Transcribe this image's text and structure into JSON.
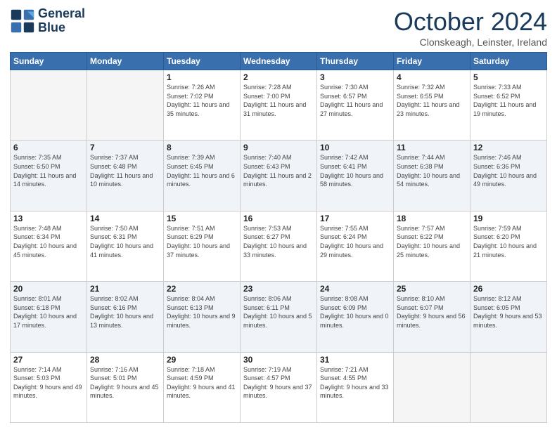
{
  "logo": {
    "line1": "General",
    "line2": "Blue"
  },
  "title": "October 2024",
  "subtitle": "Clonskeagh, Leinster, Ireland",
  "days_of_week": [
    "Sunday",
    "Monday",
    "Tuesday",
    "Wednesday",
    "Thursday",
    "Friday",
    "Saturday"
  ],
  "weeks": [
    [
      {
        "day": "",
        "info": ""
      },
      {
        "day": "",
        "info": ""
      },
      {
        "day": "1",
        "info": "Sunrise: 7:26 AM\nSunset: 7:02 PM\nDaylight: 11 hours and 35 minutes."
      },
      {
        "day": "2",
        "info": "Sunrise: 7:28 AM\nSunset: 7:00 PM\nDaylight: 11 hours and 31 minutes."
      },
      {
        "day": "3",
        "info": "Sunrise: 7:30 AM\nSunset: 6:57 PM\nDaylight: 11 hours and 27 minutes."
      },
      {
        "day": "4",
        "info": "Sunrise: 7:32 AM\nSunset: 6:55 PM\nDaylight: 11 hours and 23 minutes."
      },
      {
        "day": "5",
        "info": "Sunrise: 7:33 AM\nSunset: 6:52 PM\nDaylight: 11 hours and 19 minutes."
      }
    ],
    [
      {
        "day": "6",
        "info": "Sunrise: 7:35 AM\nSunset: 6:50 PM\nDaylight: 11 hours and 14 minutes."
      },
      {
        "day": "7",
        "info": "Sunrise: 7:37 AM\nSunset: 6:48 PM\nDaylight: 11 hours and 10 minutes."
      },
      {
        "day": "8",
        "info": "Sunrise: 7:39 AM\nSunset: 6:45 PM\nDaylight: 11 hours and 6 minutes."
      },
      {
        "day": "9",
        "info": "Sunrise: 7:40 AM\nSunset: 6:43 PM\nDaylight: 11 hours and 2 minutes."
      },
      {
        "day": "10",
        "info": "Sunrise: 7:42 AM\nSunset: 6:41 PM\nDaylight: 10 hours and 58 minutes."
      },
      {
        "day": "11",
        "info": "Sunrise: 7:44 AM\nSunset: 6:38 PM\nDaylight: 10 hours and 54 minutes."
      },
      {
        "day": "12",
        "info": "Sunrise: 7:46 AM\nSunset: 6:36 PM\nDaylight: 10 hours and 49 minutes."
      }
    ],
    [
      {
        "day": "13",
        "info": "Sunrise: 7:48 AM\nSunset: 6:34 PM\nDaylight: 10 hours and 45 minutes."
      },
      {
        "day": "14",
        "info": "Sunrise: 7:50 AM\nSunset: 6:31 PM\nDaylight: 10 hours and 41 minutes."
      },
      {
        "day": "15",
        "info": "Sunrise: 7:51 AM\nSunset: 6:29 PM\nDaylight: 10 hours and 37 minutes."
      },
      {
        "day": "16",
        "info": "Sunrise: 7:53 AM\nSunset: 6:27 PM\nDaylight: 10 hours and 33 minutes."
      },
      {
        "day": "17",
        "info": "Sunrise: 7:55 AM\nSunset: 6:24 PM\nDaylight: 10 hours and 29 minutes."
      },
      {
        "day": "18",
        "info": "Sunrise: 7:57 AM\nSunset: 6:22 PM\nDaylight: 10 hours and 25 minutes."
      },
      {
        "day": "19",
        "info": "Sunrise: 7:59 AM\nSunset: 6:20 PM\nDaylight: 10 hours and 21 minutes."
      }
    ],
    [
      {
        "day": "20",
        "info": "Sunrise: 8:01 AM\nSunset: 6:18 PM\nDaylight: 10 hours and 17 minutes."
      },
      {
        "day": "21",
        "info": "Sunrise: 8:02 AM\nSunset: 6:16 PM\nDaylight: 10 hours and 13 minutes."
      },
      {
        "day": "22",
        "info": "Sunrise: 8:04 AM\nSunset: 6:13 PM\nDaylight: 10 hours and 9 minutes."
      },
      {
        "day": "23",
        "info": "Sunrise: 8:06 AM\nSunset: 6:11 PM\nDaylight: 10 hours and 5 minutes."
      },
      {
        "day": "24",
        "info": "Sunrise: 8:08 AM\nSunset: 6:09 PM\nDaylight: 10 hours and 0 minutes."
      },
      {
        "day": "25",
        "info": "Sunrise: 8:10 AM\nSunset: 6:07 PM\nDaylight: 9 hours and 56 minutes."
      },
      {
        "day": "26",
        "info": "Sunrise: 8:12 AM\nSunset: 6:05 PM\nDaylight: 9 hours and 53 minutes."
      }
    ],
    [
      {
        "day": "27",
        "info": "Sunrise: 7:14 AM\nSunset: 5:03 PM\nDaylight: 9 hours and 49 minutes."
      },
      {
        "day": "28",
        "info": "Sunrise: 7:16 AM\nSunset: 5:01 PM\nDaylight: 9 hours and 45 minutes."
      },
      {
        "day": "29",
        "info": "Sunrise: 7:18 AM\nSunset: 4:59 PM\nDaylight: 9 hours and 41 minutes."
      },
      {
        "day": "30",
        "info": "Sunrise: 7:19 AM\nSunset: 4:57 PM\nDaylight: 9 hours and 37 minutes."
      },
      {
        "day": "31",
        "info": "Sunrise: 7:21 AM\nSunset: 4:55 PM\nDaylight: 9 hours and 33 minutes."
      },
      {
        "day": "",
        "info": ""
      },
      {
        "day": "",
        "info": ""
      }
    ]
  ]
}
